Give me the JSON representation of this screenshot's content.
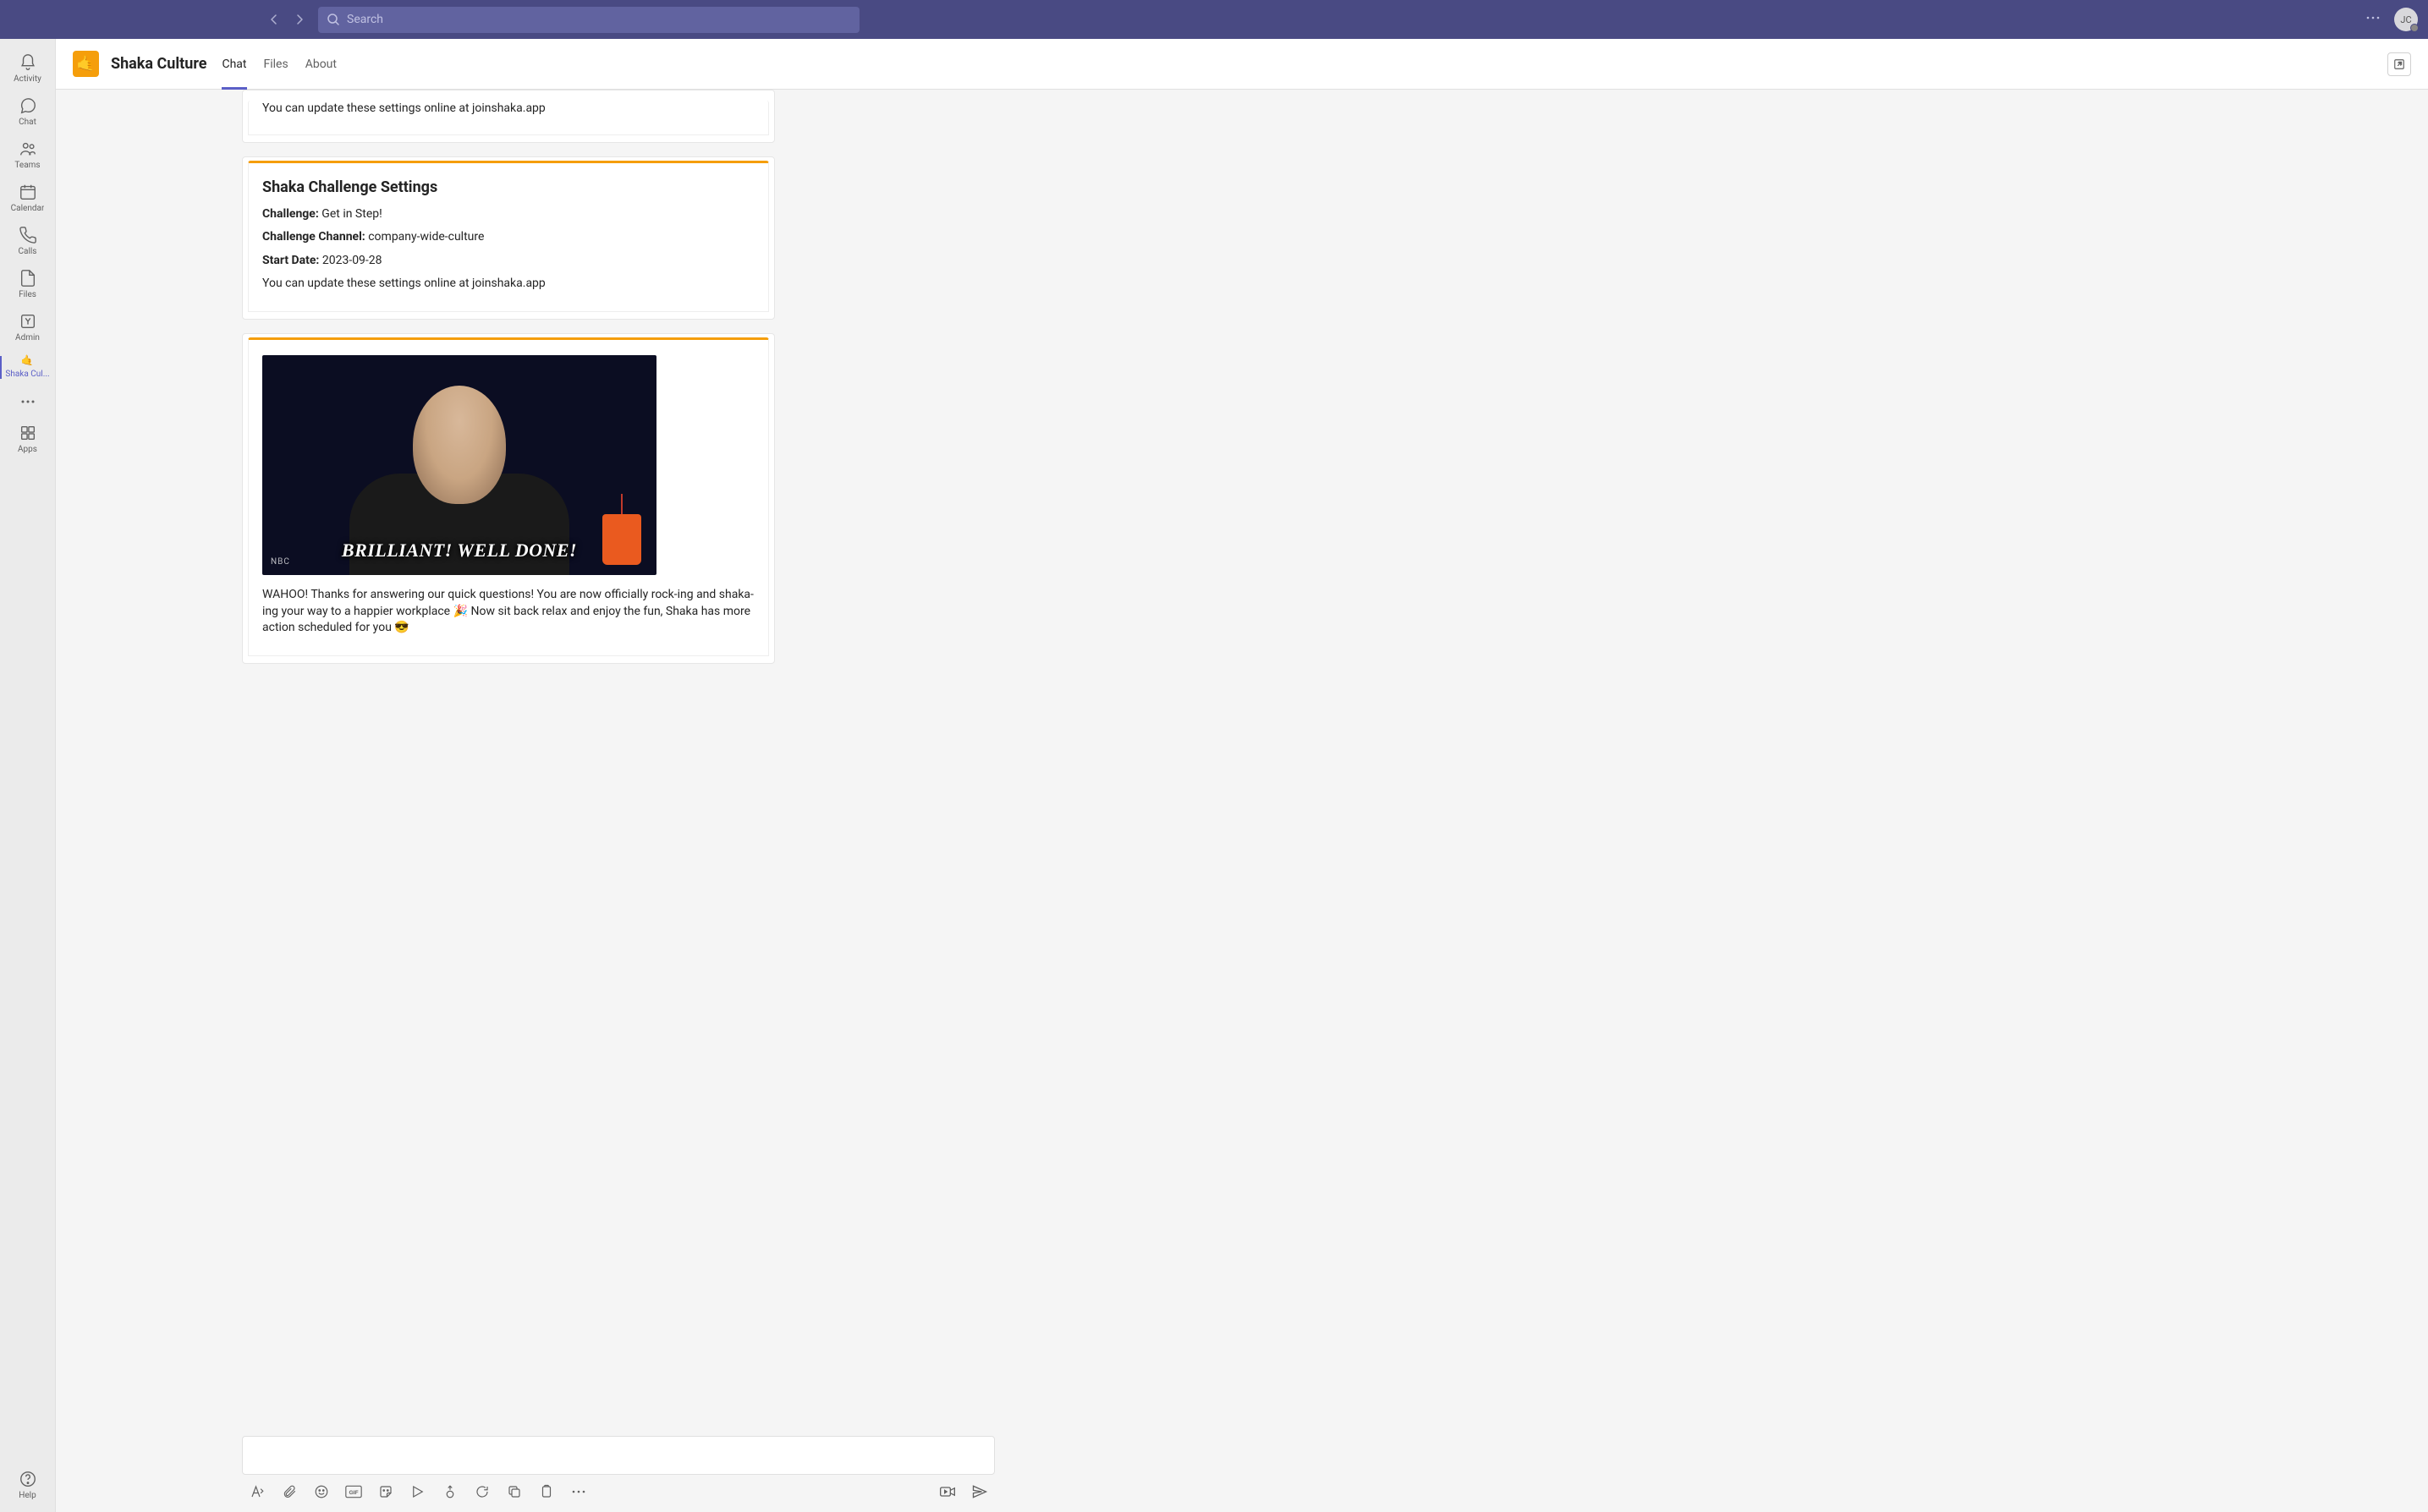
{
  "search": {
    "placeholder": "Search"
  },
  "avatar": {
    "initials": "JC"
  },
  "rail": {
    "items": [
      {
        "label": "Activity"
      },
      {
        "label": "Chat"
      },
      {
        "label": "Teams"
      },
      {
        "label": "Calendar"
      },
      {
        "label": "Calls"
      },
      {
        "label": "Files"
      },
      {
        "label": "Admin"
      },
      {
        "label": "Shaka Cul..."
      }
    ],
    "apps_label": "Apps",
    "help_label": "Help"
  },
  "header": {
    "title": "Shaka Culture",
    "tabs": [
      {
        "label": "Chat"
      },
      {
        "label": "Files"
      },
      {
        "label": "About"
      }
    ]
  },
  "messages": {
    "peek_text": "You can update these settings online at joinshaka.app",
    "card1": {
      "title": "Shaka Challenge Settings",
      "challenge_label": "Challenge:",
      "challenge_value": " Get in Step!",
      "channel_label": "Challenge Channel:",
      "channel_value": " company-wide-culture",
      "start_label": "Start Date:",
      "start_value": " 2023-09-28",
      "footer": "You can update these settings online at joinshaka.app"
    },
    "card2": {
      "gif_caption": "BRILLIANT! WELL DONE!",
      "gif_logo": "NBC",
      "body": "WAHOO! Thanks for answering our quick questions! You are now officially rock-ing and shaka-ing your way to a happier workplace 🎉 Now sit back relax and enjoy the fun, Shaka has more action scheduled for you 😎"
    }
  },
  "compose": {
    "placeholder": ""
  }
}
